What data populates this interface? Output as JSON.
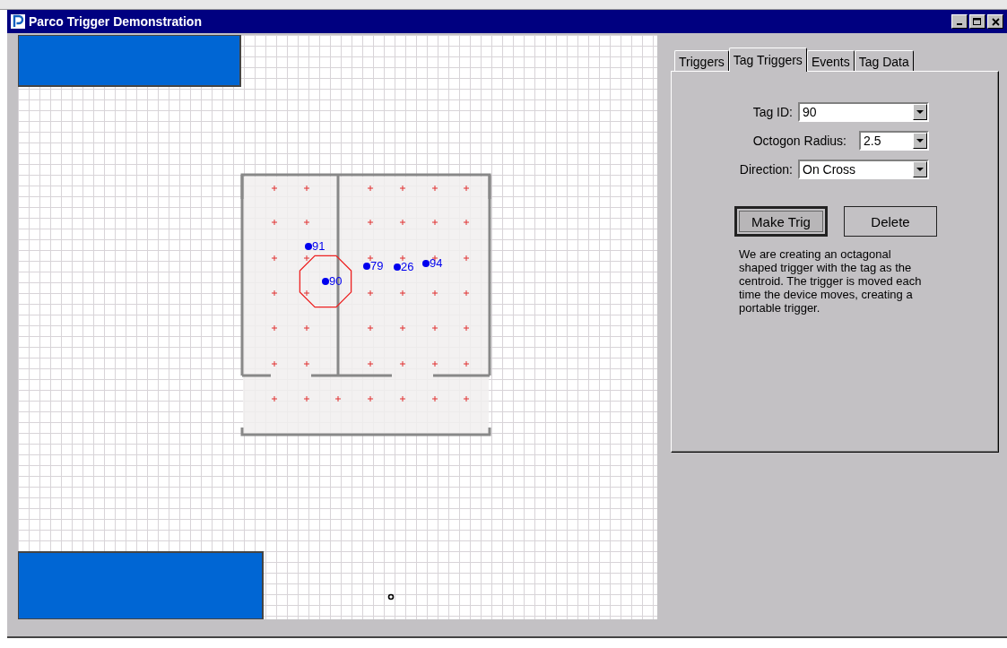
{
  "window": {
    "title": "Parco Trigger Demonstration"
  },
  "canvas": {
    "tags": [
      {
        "label": "91",
        "selected": false
      },
      {
        "label": "79",
        "selected": false
      },
      {
        "label": "26",
        "selected": false
      },
      {
        "label": "94",
        "selected": false
      },
      {
        "label": "90",
        "selected": true
      }
    ]
  },
  "tabs": [
    {
      "label": "Triggers",
      "selected": false
    },
    {
      "label": "Tag Triggers",
      "selected": true
    },
    {
      "label": "Events",
      "selected": false
    },
    {
      "label": "Tag Data",
      "selected": false
    }
  ],
  "form": [
    {
      "label": "Tag ID:",
      "value": "90",
      "kind": "wide"
    },
    {
      "label": "Octogon Radius:",
      "value": "2.5",
      "kind": "narrow"
    },
    {
      "label": "Direction:",
      "value": "On Cross",
      "kind": "wide"
    }
  ],
  "buttons": [
    {
      "label": "Make Trig",
      "focused": true
    },
    {
      "label": "Delete",
      "focused": false
    }
  ],
  "description": "We are creating an octagonal shaped trigger with the tag as the centroid. The trigger is moved each time the device moves, creating a portable trigger."
}
